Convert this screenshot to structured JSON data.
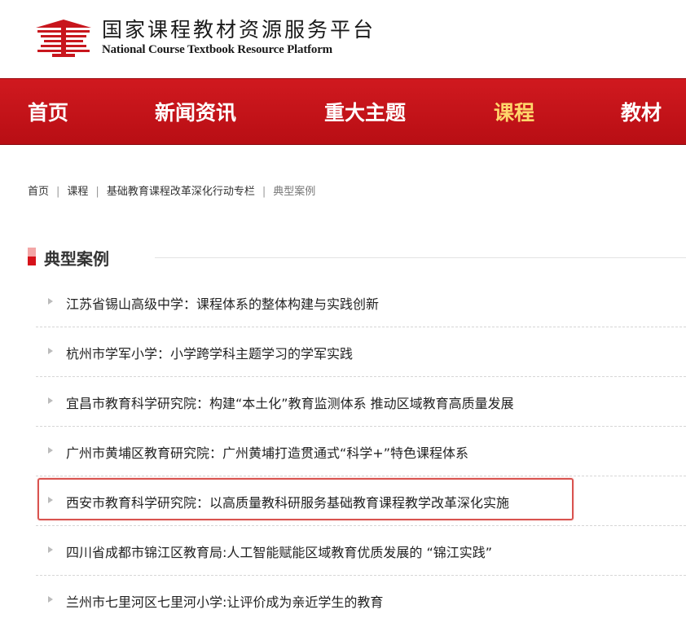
{
  "header": {
    "title_cn": "国家课程教材资源服务平台",
    "title_en": "National Course Textbook Resource Platform",
    "logo_icon": "building-columns-logo-icon"
  },
  "nav": {
    "items": [
      {
        "label": "首页",
        "active": false
      },
      {
        "label": "新闻资讯",
        "active": false
      },
      {
        "label": "重大主题",
        "active": false
      },
      {
        "label": "课程",
        "active": true
      },
      {
        "label": "教材",
        "active": false
      }
    ],
    "active_color": "#ffd66b",
    "background_color": "#c81219"
  },
  "breadcrumb": {
    "items": [
      "首页",
      "课程",
      "基础教育课程改革深化行动专栏",
      "典型案例"
    ],
    "separator": "|"
  },
  "section": {
    "title": "典型案例",
    "accent_color": "#d6121a"
  },
  "list": {
    "items": [
      {
        "text": "江苏省锡山高级中学：课程体系的整体构建与实践创新"
      },
      {
        "text": "杭州市学军小学：小学跨学科主题学习的学军实践"
      },
      {
        "text": "宜昌市教育科学研究院：构建“本土化”教育监测体系 推动区域教育高质量发展"
      },
      {
        "text": "广州市黄埔区教育研究院：广州黄埔打造贯通式“科学+”特色课程体系"
      },
      {
        "text": "西安市教育科学研究院：以高质量教科研服务基础教育课程教学改革深化实施",
        "highlighted": true
      },
      {
        "text": "四川省成都市锦江区教育局:人工智能赋能区域教育优质发展的 “锦江实践”"
      },
      {
        "text": "兰州市七里河区七里河小学:让评价成为亲近学生的教育"
      }
    ],
    "highlight_color": "#d9534f"
  }
}
